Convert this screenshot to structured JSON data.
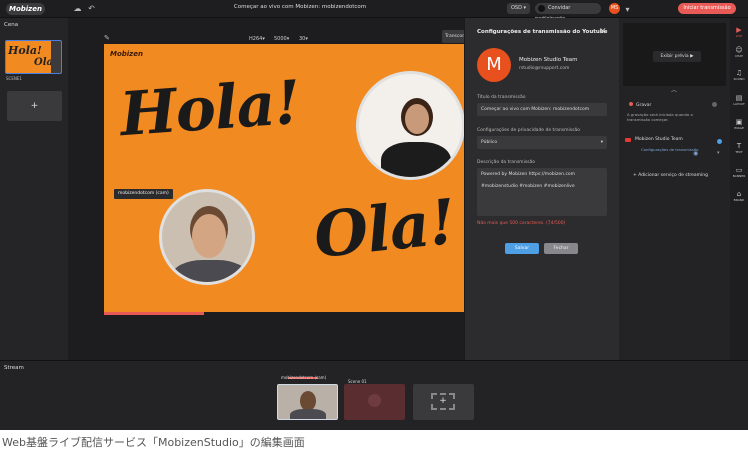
{
  "app": {
    "logo": "Mobizen",
    "title": "Começar ao vivo com Mobizen: mobizendotcom",
    "quality": "OSD",
    "invite_label": "Convidar participante",
    "avatar_initials": "MS",
    "start_label": "Iniciar transmissão"
  },
  "scenes": {
    "heading": "Cena",
    "thumb_text_1": "Hola!",
    "thumb_text_2": "Ola!",
    "scene_name": "SCENE1",
    "add_symbol": "+"
  },
  "stage": {
    "codec": "H264",
    "bitrate": "5000",
    "fps": "30",
    "transcode_label": "Transcodificar",
    "watermark": "Mobizen",
    "text_hola": "Hola!",
    "text_ola": "Ola!",
    "cam_label": "mobizendotcom (cam)"
  },
  "modal": {
    "title": "Configurações de transmissão do Youtube",
    "account_initial": "M",
    "account_name": "Mobizen Studio Team",
    "account_email": "rstudio@rsupport.com",
    "title_label": "Título da transmissão",
    "title_value": "Começar ao vivo com Mobizen: mobizendotcom",
    "privacy_label": "Configurações de privacidade de transmissão",
    "privacy_value": "Público",
    "desc_label": "Descrição da transmissão",
    "desc_line1": "Powered by Mobizen https://mobizen.com",
    "desc_line2": "#mobizenstudio #mobizen #mobizenlive",
    "warning": "Não mais que 500 caracteres. (74/500)",
    "save_label": "Salvar",
    "cancel_label": "Fechar"
  },
  "right": {
    "preview_label": "Exibir prévia",
    "record_title": "Gravar",
    "record_desc": "A gravação será iniciada quando a transmissão começar.",
    "yt_account": "Mobizen Studio Team",
    "yt_settings_link": "Configurações de transmissão",
    "add_service": "Adicionar serviço de streaming"
  },
  "toolbar": {
    "items": [
      {
        "icon": "live-icon",
        "glyph": "▶",
        "label": "LIVE"
      },
      {
        "icon": "chat-icon",
        "glyph": "☺",
        "label": "CHAT"
      },
      {
        "icon": "sound-icon",
        "glyph": "♫",
        "label": "SOUND"
      },
      {
        "icon": "layout-icon",
        "glyph": "▤",
        "label": "LAYOUT"
      },
      {
        "icon": "image-icon",
        "glyph": "▣",
        "label": "IMAGE"
      },
      {
        "icon": "text-icon",
        "glyph": "T",
        "label": "TEXT"
      },
      {
        "icon": "banner-icon",
        "glyph": "▭",
        "label": "BANNER"
      },
      {
        "icon": "brand-icon",
        "glyph": "⌂",
        "label": "BRAND"
      }
    ]
  },
  "stream": {
    "heading": "Stream",
    "card1_head": "mobizendotcom (cam)",
    "card2_head": "Scene 01",
    "add_symbol": "+"
  },
  "caption": "Web基盤ライブ配信サービス「MobizenStudio」の編集画面",
  "colors": {
    "accent": "#e85a55",
    "canvas_orange": "#f28a22",
    "primary_blue": "#4f9fe5"
  }
}
